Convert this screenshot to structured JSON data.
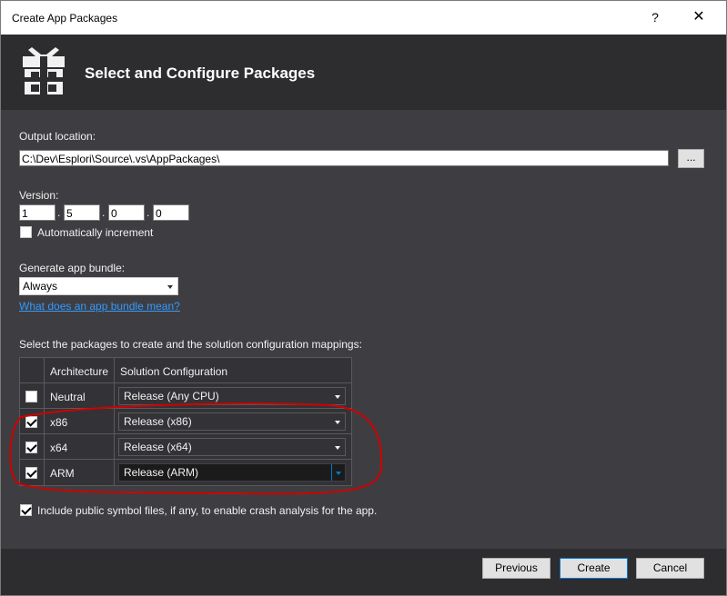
{
  "window": {
    "title": "Create App Packages",
    "help_label": "?",
    "close_label": "✕"
  },
  "header": {
    "heading": "Select and Configure Packages"
  },
  "output": {
    "label": "Output location:",
    "path": "C:\\Dev\\Esplori\\Source\\.vs\\AppPackages\\",
    "browse_label": "..."
  },
  "version": {
    "label": "Version:",
    "parts": [
      "1",
      "5",
      "0",
      "0"
    ],
    "separator": ".",
    "auto_increment_label": "Automatically increment",
    "auto_increment_checked": false
  },
  "bundle": {
    "label": "Generate app bundle:",
    "selected": "Always",
    "help_link": "What does an app bundle mean?"
  },
  "packages": {
    "intro": "Select the packages to create and the solution configuration mappings:",
    "headers": {
      "architecture": "Architecture",
      "configuration": "Solution Configuration"
    },
    "rows": [
      {
        "checked": false,
        "architecture": "Neutral",
        "configuration": "Release (Any CPU)"
      },
      {
        "checked": true,
        "architecture": "x86",
        "configuration": "Release (x86)"
      },
      {
        "checked": true,
        "architecture": "x64",
        "configuration": "Release (x64)"
      },
      {
        "checked": true,
        "architecture": "ARM",
        "configuration": "Release (ARM)"
      }
    ]
  },
  "symbols": {
    "label": "Include public symbol files, if any, to enable crash analysis for the app.",
    "checked": true
  },
  "footer": {
    "previous_label": "Previous",
    "create_label": "Create",
    "cancel_label": "Cancel"
  },
  "colors": {
    "window_background": "#2d2d30",
    "content_background": "#3e3e42",
    "link": "#3399ff",
    "annotation": "#d10000",
    "focus_accent": "#007acc"
  }
}
